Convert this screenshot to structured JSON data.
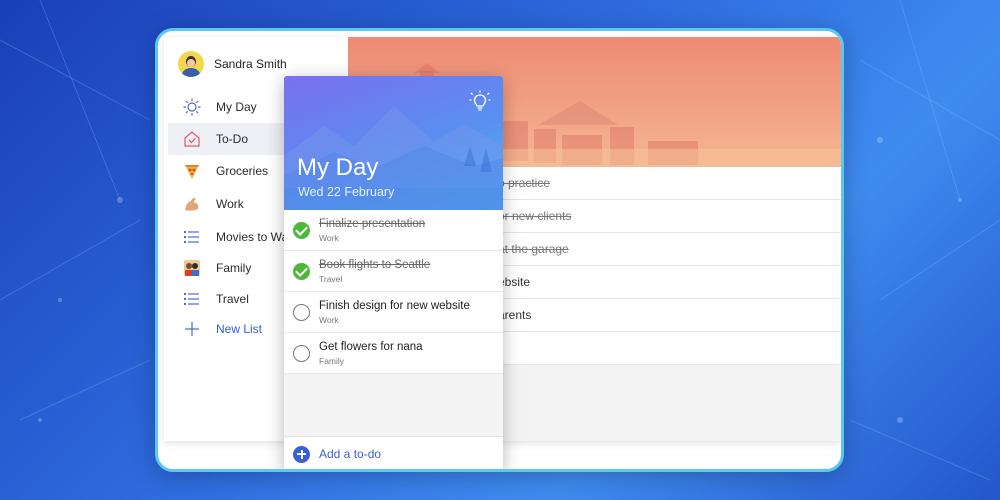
{
  "user": {
    "name": "Sandra Smith"
  },
  "sidebar": {
    "items": [
      {
        "label": "My Day",
        "icon": "sun-icon"
      },
      {
        "label": "To-Do",
        "icon": "home-icon",
        "active": true
      },
      {
        "label": "Groceries",
        "icon": "pizza-icon"
      },
      {
        "label": "Work",
        "icon": "flexed-arm-icon"
      },
      {
        "label": "Movies to Wat",
        "icon": "list-icon"
      },
      {
        "label": "Family",
        "icon": "family-icon"
      },
      {
        "label": "Travel",
        "icon": "list-icon"
      }
    ],
    "new_list": "New List"
  },
  "back_tasks": [
    {
      "text": "o practice",
      "done": true
    },
    {
      "text": "or new clients",
      "done": true
    },
    {
      "text": "at the garage",
      "done": true
    },
    {
      "text": "ebsite",
      "done": false
    },
    {
      "text": "arents",
      "done": false
    },
    {
      "text": "",
      "done": false
    }
  ],
  "my_day": {
    "title": "My Day",
    "date": "Wed 22 February",
    "tasks": [
      {
        "title": "Finalize presentation",
        "list": "Work",
        "done": true
      },
      {
        "title": "Book flights to Seattle",
        "list": "Travel",
        "done": true
      },
      {
        "title": "Finish design for new website",
        "list": "Work",
        "done": false
      },
      {
        "title": "Get flowers for nana",
        "list": "Family",
        "done": false
      }
    ],
    "add_label": "Add a to-do"
  },
  "colors": {
    "accent": "#3a60d6",
    "check_done": "#4fb83b",
    "hero_top": "#ee8a75",
    "myday_top": "#7b6ff0",
    "myday_bottom": "#44b8f0"
  }
}
